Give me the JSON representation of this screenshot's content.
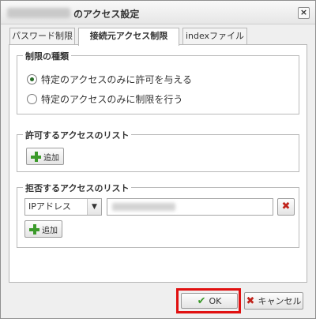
{
  "dialog": {
    "title": "のアクセス設定",
    "close_label": "×"
  },
  "tabs": [
    {
      "label": "パスワード制限",
      "active": false
    },
    {
      "label": "接続元アクセス制限",
      "active": true
    },
    {
      "label": "indexファイル",
      "active": false
    }
  ],
  "restriction_type": {
    "legend": "制限の種類",
    "options": [
      {
        "label": "特定のアクセスのみに許可を与える",
        "checked": true
      },
      {
        "label": "特定のアクセスのみに制限を行う",
        "checked": false
      }
    ]
  },
  "allow_list": {
    "legend": "許可するアクセスのリスト",
    "add_label": "追加"
  },
  "deny_list": {
    "legend": "拒否するアクセスのリスト",
    "type_selected": "IPアドレス",
    "add_label": "追加"
  },
  "footer": {
    "ok_label": "OK",
    "cancel_label": "キャンセル"
  },
  "colors": {
    "highlight": "#e01010",
    "add_icon": "#3b9a2a",
    "delete_icon": "#c0231b"
  }
}
